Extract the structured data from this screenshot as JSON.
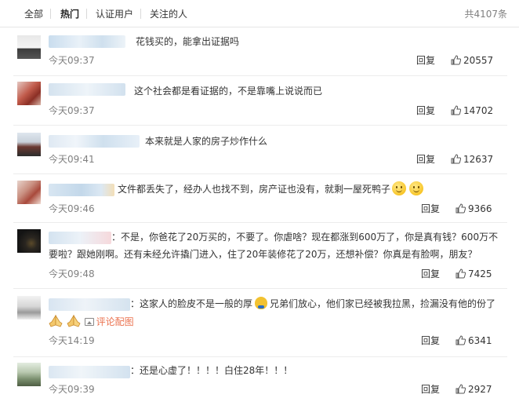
{
  "tabs": [
    "全部",
    "热门",
    "认证用户",
    "关注的人"
  ],
  "active_tab": "热门",
  "total": "共4107条",
  "reply_label": "回复",
  "comments": [
    {
      "text": "花钱买的，能拿出证据吗",
      "time": "今天09:37",
      "likes": "20557"
    },
    {
      "text": "这个社会都是看证据的，不是靠嘴上说说而已",
      "time": "今天09:37",
      "likes": "14702"
    },
    {
      "text": "本来就是人家的房子炒作什么",
      "time": "今天09:41",
      "likes": "12637"
    },
    {
      "text": "文件都丢失了，经办人也找不到，房产证也没有，就剩一屋死鸭子",
      "time": "今天09:46",
      "likes": "9366"
    },
    {
      "text_line1": "：不是，你爸花了20万买的，不要了。你虐啥？现在都涨到600万了，你是真有钱？600万不",
      "text_line2": "要啦？跟她刚啊。还有未经允许撬门进入，住了20年装修花了20万，还想补偿？你真是有脸啊，朋友？",
      "time": "今天09:48",
      "likes": "7425"
    },
    {
      "text_a": "：这家人的脸皮不是一般的厚",
      "text_b": "兄弟们放心，他们家已经被我拉黑，捡漏没有他的份了",
      "image_link": "评论配图",
      "time": "今天14:19",
      "likes": "6341"
    },
    {
      "text": "：还是心虚了！！！！白住28年！！！",
      "time": "今天09:39",
      "likes": "2927"
    }
  ],
  "colors": {
    "accent": "#eb7350",
    "muted": "#808080",
    "text": "#333333"
  },
  "icons": {
    "like": "thumbs-up-icon",
    "emoji": "smile-emoji-icon",
    "image": "image-icon"
  }
}
